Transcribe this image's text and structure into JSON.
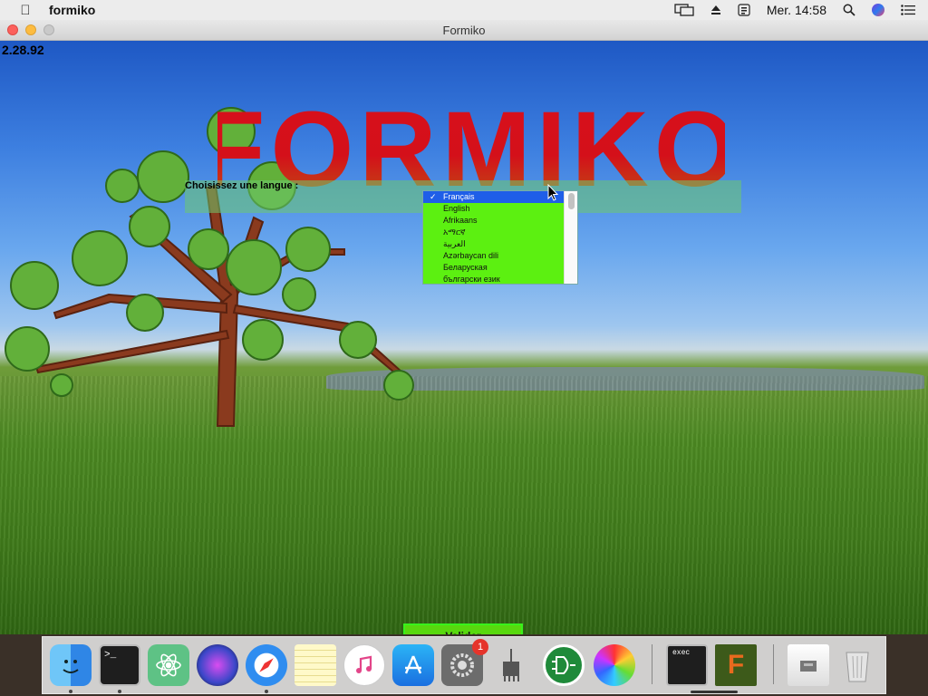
{
  "menubar": {
    "app_name": "formiko",
    "datetime": "Mer. 14:58"
  },
  "window": {
    "title": "Formiko"
  },
  "app": {
    "version": "2.28.92",
    "logo_text": "FORMIKO",
    "language_prompt": "Choisissez une langue :",
    "languages": [
      "Français",
      "English",
      "Afrikaans",
      "አማርኛ",
      "العربية",
      "Azərbaycan dili",
      "Беларуская",
      "български език"
    ],
    "selected_language_index": 0,
    "submit_label": "Valider"
  },
  "dock": {
    "items": [
      "Finder",
      "Terminal",
      "Atom",
      "Siri",
      "Safari",
      "Notes",
      "iTunes",
      "App Store",
      "System Preferences",
      "Vysor",
      "Logisim",
      "Photos",
      "exec",
      "Formiko",
      "Document",
      "Trash"
    ],
    "system_prefs_badge": "1",
    "exec_label": "exec"
  }
}
